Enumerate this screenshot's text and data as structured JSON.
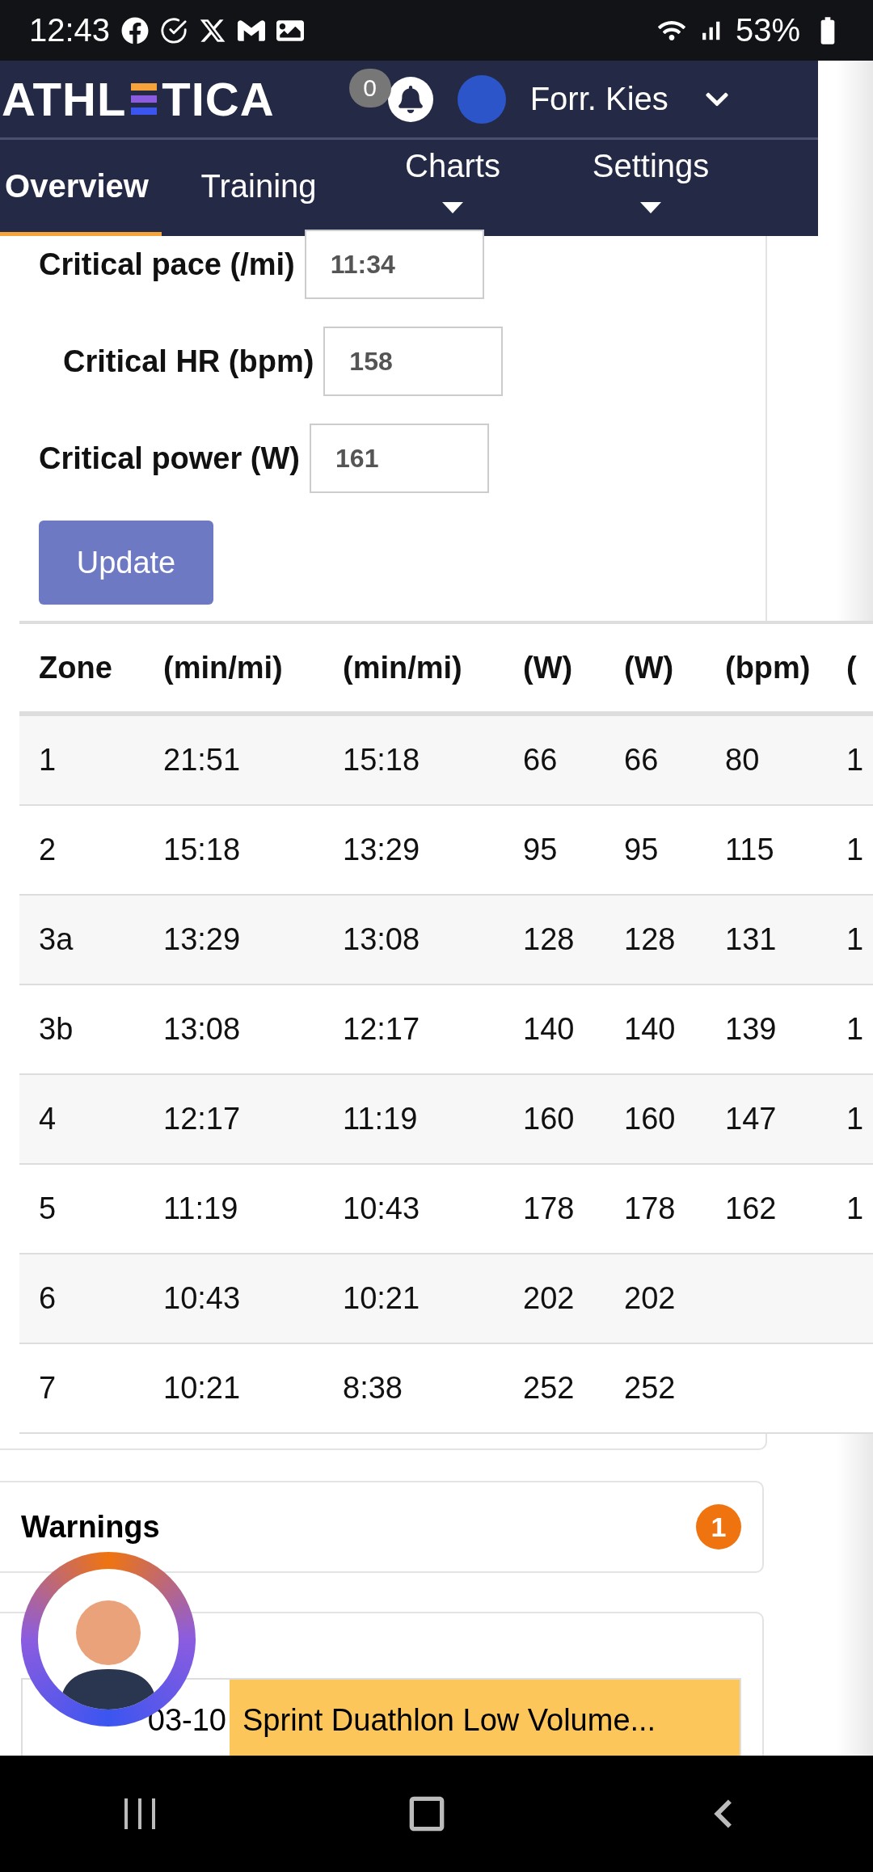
{
  "status_bar": {
    "time": "12:43",
    "battery": "53%"
  },
  "header": {
    "logo_left": "ATHL",
    "logo_right": "TICA",
    "notification_count": "0",
    "user_name": "Forr. Kies"
  },
  "tabs": [
    {
      "label": "Overview",
      "selected": true,
      "kind": "link"
    },
    {
      "label": "Training",
      "selected": false,
      "kind": "link"
    },
    {
      "label": "Charts",
      "selected": false,
      "kind": "dropdown"
    },
    {
      "label": "Settings",
      "selected": false,
      "kind": "dropdown"
    }
  ],
  "form": {
    "fields": [
      {
        "label": "Critical pace (/mi)",
        "value": "11:34"
      },
      {
        "label": "Critical HR (bpm)",
        "value": "158"
      },
      {
        "label": "Critical power (W)",
        "value": "161"
      }
    ],
    "button": "Update"
  },
  "zones_table": {
    "columns": [
      "Zone",
      "(min/mi)",
      "(min/mi)",
      "(W)",
      "(W)",
      "(bpm)",
      "("
    ],
    "rows": [
      [
        "1",
        "21:51",
        "15:18",
        "66",
        "66",
        "80",
        "1"
      ],
      [
        "2",
        "15:18",
        "13:29",
        "95",
        "95",
        "115",
        "1"
      ],
      [
        "3a",
        "13:29",
        "13:08",
        "128",
        "128",
        "131",
        "1"
      ],
      [
        "3b",
        "13:08",
        "12:17",
        "140",
        "140",
        "139",
        "1"
      ],
      [
        "4",
        "12:17",
        "11:19",
        "160",
        "160",
        "147",
        "1"
      ],
      [
        "5",
        "11:19",
        "10:43",
        "178",
        "178",
        "162",
        "1"
      ],
      [
        "6",
        "10:43",
        "10:21",
        "202",
        "202",
        "",
        ""
      ],
      [
        "7",
        "10:21",
        "8:38",
        "252",
        "252",
        "",
        ""
      ]
    ]
  },
  "warnings": {
    "title": "Warnings",
    "count": "1"
  },
  "plan": {
    "date": "03-10",
    "name": "Sprint Duathlon Low Volume..."
  }
}
